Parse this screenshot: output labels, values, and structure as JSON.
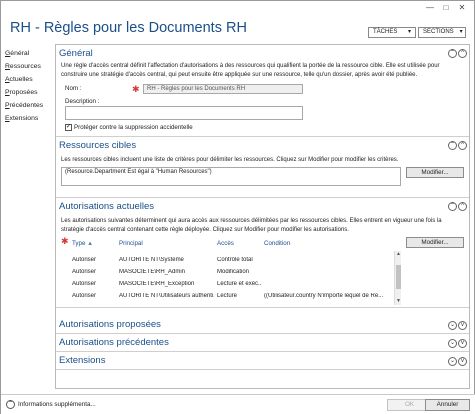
{
  "window": {
    "title": "RH - Règles pour les Documents RH",
    "minimize": "—",
    "maximize": "□",
    "close": "✕"
  },
  "toolbar": {
    "taches": "TÂCHES",
    "sections": "SECTIONS",
    "chevron": "▾"
  },
  "nav": {
    "items": [
      {
        "label": "Général",
        "u": "G",
        "rest": "énéral"
      },
      {
        "label": "Ressources",
        "u": "R",
        "rest": "essources"
      },
      {
        "label": "Actuelles",
        "u": "A",
        "rest": "ctuelles"
      },
      {
        "label": "Proposées",
        "u": "P",
        "rest": "roposées"
      },
      {
        "label": "Précédentes",
        "u": "P",
        "rest": "récédentes"
      },
      {
        "label": "Extensions",
        "u": "E",
        "rest": "xtensions"
      }
    ]
  },
  "general": {
    "heading": "Général",
    "description": "Une règle d'accès central définit l'affectation d'autorisations à des ressources qui qualifient la portée de la ressource cible. Elle est utilisée pour construire une stratégie d'accès central, qui peut ensuite être appliquée sur une ressource, telle qu'un dossier, après avoir été publiée.",
    "name_label": "Nom :",
    "name_value": "RH - Règles pour les Documents RH",
    "desc_label": "Description :",
    "protect_label": "Protéger contre la suppression accidentelle",
    "protect_checked": "✓"
  },
  "ressources": {
    "heading": "Ressources cibles",
    "description": "Les ressources cibles incluent une liste de critères pour délimiter les ressources. Cliquez sur Modifier pour modifier les critères.",
    "condition": "(Resource.Department Est égal à \"Human Resources\")",
    "modify_button": "Modifier..."
  },
  "actuelles": {
    "heading": "Autorisations actuelles",
    "description": "Les autorisations suivantes déterminent qui aura accès aux ressources délimitées par les ressources cibles. Elles entrent en vigueur une fois la stratégie d'accès central contenant cette règle déployée. Cliquez sur Modifier pour modifier les autorisations.",
    "modify_button": "Modifier...",
    "columns": [
      "Type",
      "Principal",
      "Accès",
      "Condition"
    ],
    "sort_arrow": "▲",
    "rows": [
      {
        "type": "Autoriser",
        "principal": "AUTORITE NT\\Système",
        "acces": "Contrôle total",
        "condition": ""
      },
      {
        "type": "Autoriser",
        "principal": "MASOCIETE\\RH_Admin",
        "acces": "Modification",
        "condition": ""
      },
      {
        "type": "Autoriser",
        "principal": "MASOCIETE\\RH_Exception",
        "acces": "Lecture et exéc...",
        "condition": ""
      },
      {
        "type": "Autoriser",
        "principal": "AUTORITE NT\\Utilisateurs authenti...",
        "acces": "Lecture",
        "condition": "((Utilisateur.country N'importe lequel de Re..."
      }
    ]
  },
  "proposees": {
    "heading": "Autorisations proposées"
  },
  "precedentes": {
    "heading": "Autorisations précédentes"
  },
  "extensions": {
    "heading": "Extensions"
  },
  "section_icons": {
    "collapse": "^",
    "expand": "v",
    "up": "⌃",
    "down": "⌄"
  },
  "footer": {
    "info_icon": "⌃",
    "info_label": "Informations supplémenta...",
    "ok": "OK",
    "cancel": "Annuler"
  },
  "colors": {
    "accent": "#1b4f8a",
    "required": "#d43a3a"
  }
}
